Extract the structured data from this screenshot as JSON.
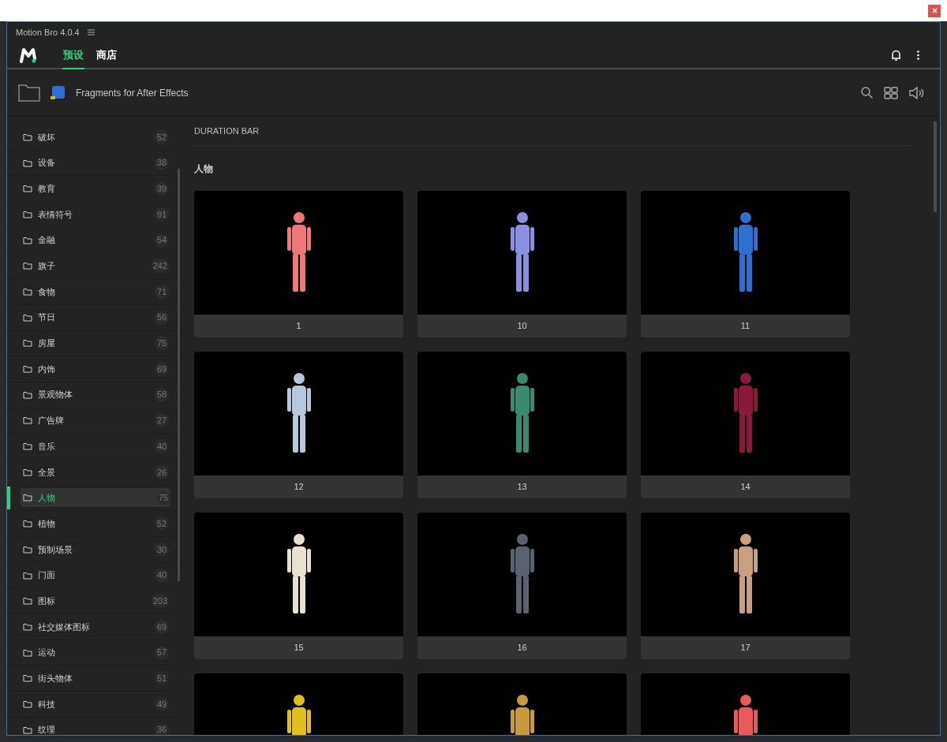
{
  "app_title": "Motion Bro 4.0.4",
  "tabs": [
    {
      "label": "预设",
      "selected": true
    },
    {
      "label": "商店",
      "selected": false
    }
  ],
  "pack_title": "Fragments for After Effects",
  "categories": [
    {
      "label": "破坏",
      "count": "52",
      "selected": false
    },
    {
      "label": "设备",
      "count": "38",
      "selected": false
    },
    {
      "label": "教育",
      "count": "39",
      "selected": false
    },
    {
      "label": "表情符号",
      "count": "91",
      "selected": false
    },
    {
      "label": "金融",
      "count": "54",
      "selected": false
    },
    {
      "label": "旗子",
      "count": "242",
      "selected": false
    },
    {
      "label": "食物",
      "count": "71",
      "selected": false
    },
    {
      "label": "节日",
      "count": "56",
      "selected": false
    },
    {
      "label": "房屋",
      "count": "75",
      "selected": false
    },
    {
      "label": "内饰",
      "count": "69",
      "selected": false
    },
    {
      "label": "景观物体",
      "count": "58",
      "selected": false
    },
    {
      "label": "广告牌",
      "count": "27",
      "selected": false
    },
    {
      "label": "音乐",
      "count": "40",
      "selected": false
    },
    {
      "label": "全景",
      "count": "26",
      "selected": false
    },
    {
      "label": "人物",
      "count": "75",
      "selected": true
    },
    {
      "label": "植物",
      "count": "52",
      "selected": false
    },
    {
      "label": "预制场景",
      "count": "30",
      "selected": false
    },
    {
      "label": "门面",
      "count": "40",
      "selected": false
    },
    {
      "label": "图标",
      "count": "203",
      "selected": false
    },
    {
      "label": "社交媒体图标",
      "count": "69",
      "selected": false
    },
    {
      "label": "运动",
      "count": "57",
      "selected": false
    },
    {
      "label": "街头物体",
      "count": "51",
      "selected": false
    },
    {
      "label": "科技",
      "count": "49",
      "selected": false
    },
    {
      "label": "纹理",
      "count": "36",
      "selected": false
    }
  ],
  "duration_bar": "DURATION BAR",
  "section_title": "人物",
  "presets": [
    {
      "label": "1",
      "color": "#f07878"
    },
    {
      "label": "10",
      "color": "#8a8fe0"
    },
    {
      "label": "11",
      "color": "#2f6fd0"
    },
    {
      "label": "12",
      "color": "#b8c8dc"
    },
    {
      "label": "13",
      "color": "#3a8a70"
    },
    {
      "label": "14",
      "color": "#8a1a3a"
    },
    {
      "label": "15",
      "color": "#e8e0d0"
    },
    {
      "label": "16",
      "color": "#5a6270"
    },
    {
      "label": "17",
      "color": "#c8a080"
    },
    {
      "color": "#e0c020"
    },
    {
      "color": "#c89a40"
    },
    {
      "color": "#e85a5a"
    }
  ]
}
